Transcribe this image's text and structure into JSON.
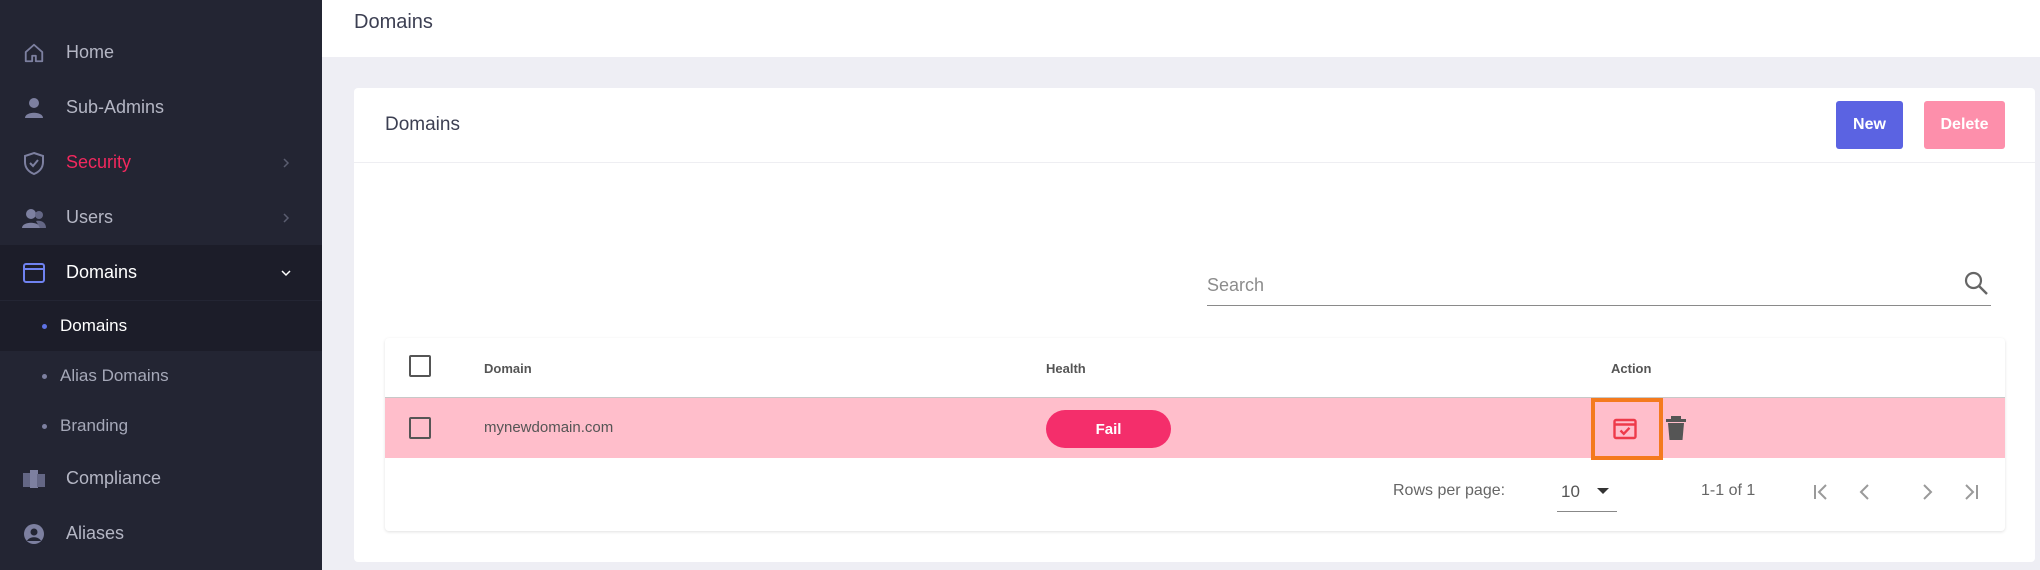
{
  "sidebar": {
    "items": [
      {
        "label": "Home",
        "icon": "home-icon"
      },
      {
        "label": "Sub-Admins",
        "icon": "person-icon"
      },
      {
        "label": "Security",
        "icon": "shield-icon"
      },
      {
        "label": "Users",
        "icon": "users-icon"
      },
      {
        "label": "Domains",
        "icon": "browser-window-icon"
      },
      {
        "label": "Compliance",
        "icon": "compliance-icon"
      },
      {
        "label": "Aliases",
        "icon": "aliases-icon"
      }
    ],
    "domains_sub": [
      {
        "label": "Domains"
      },
      {
        "label": "Alias Domains"
      },
      {
        "label": "Branding"
      }
    ],
    "colors": {
      "background": "#232533",
      "active": "#f2285e",
      "accent": "#5e72e4"
    }
  },
  "topbar": {
    "title": "Domains"
  },
  "card": {
    "title": "Domains",
    "new_label": "New",
    "delete_label": "Delete"
  },
  "search": {
    "placeholder": "Search"
  },
  "table": {
    "columns": [
      "Domain",
      "Health",
      "Action"
    ],
    "rows": [
      {
        "domain": "mynewdomain.com",
        "health": "Fail"
      }
    ]
  },
  "pagination": {
    "rows_per_page_label": "Rows per page:",
    "rows_per_page": "10",
    "range": "1-1 of 1"
  }
}
